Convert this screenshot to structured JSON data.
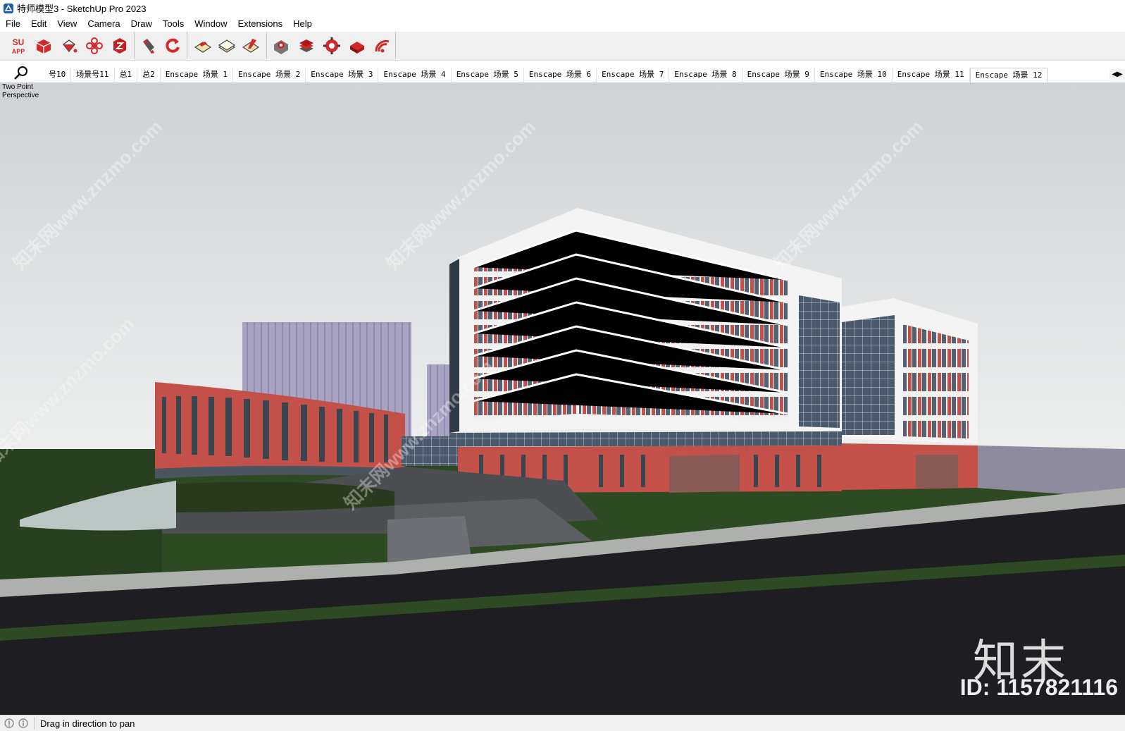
{
  "window": {
    "title": "特师模型3 - SketchUp Pro 2023"
  },
  "menu": {
    "items": [
      "File",
      "Edit",
      "View",
      "Camera",
      "Draw",
      "Tools",
      "Window",
      "Extensions",
      "Help"
    ]
  },
  "toolbar": {
    "su_app_label_top": "SU",
    "su_app_label_bottom": "APP",
    "icons": [
      "su-app-icon",
      "push-pull-box-icon",
      "paint-bucket-icon",
      "flower-settings-icon",
      "red-cube-icon",
      "magnet-icon",
      "rotate-icon",
      "layer-flag-icon",
      "layer-stack-icon",
      "layer-edit-icon",
      "gear-box-icon",
      "stacked-books-icon",
      "gear-red-icon",
      "wand-box-icon",
      "wifi-red-icon"
    ]
  },
  "scenes": {
    "tabs": [
      "号10",
      "场景号11",
      "总1",
      "总2",
      "Enscape 场景 1",
      "Enscape 场景 2",
      "Enscape 场景 3",
      "Enscape 场景 4",
      "Enscape 场景 5",
      "Enscape 场景 6",
      "Enscape 场景 7",
      "Enscape 场景 8",
      "Enscape 场景 9",
      "Enscape 场景 10",
      "Enscape 场景 11",
      "Enscape 场景 12"
    ],
    "active_index": 15,
    "scroll_label": "◀▶"
  },
  "viewport": {
    "camera_line1": "Two Point",
    "camera_line2": "Perspective",
    "watermark_text": "知末网www.znzmo.com",
    "brand_text": "知末",
    "brand_id": "ID: 1157821116"
  },
  "status": {
    "message": "Drag in direction to pan",
    "icons": [
      "geo-location-icon",
      "info-icon"
    ]
  },
  "colors": {
    "sky": "#d8dadc",
    "facade_red": "#c4504a",
    "grass": "#2e4a22",
    "road": "#1e1e22",
    "accent_red": "#d22a2a"
  }
}
